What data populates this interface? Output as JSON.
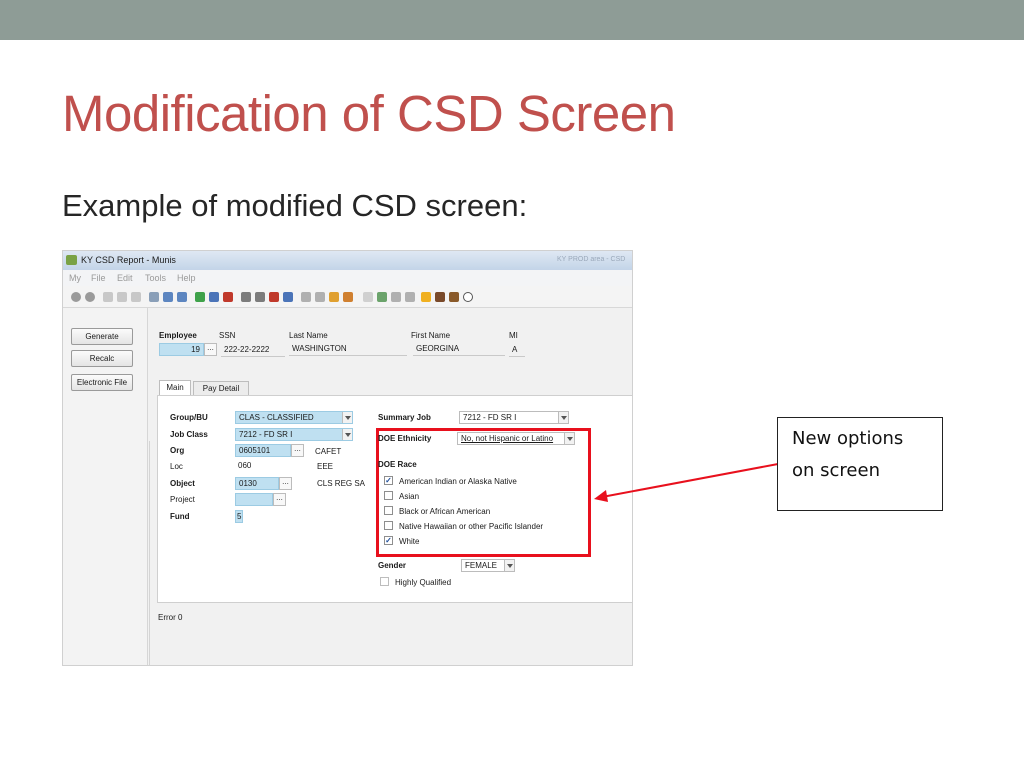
{
  "slide": {
    "title": "Modification of CSD Screen",
    "subtitle": "Example of modified CSD screen:"
  },
  "window": {
    "title": "KY CSD Report - Munis",
    "ghost_text": "KY PROD area - CSD"
  },
  "menu": [
    "My",
    "File",
    "Edit",
    "Tools",
    "Help"
  ],
  "side_buttons": [
    "Generate",
    "Recalc",
    "Electronic File"
  ],
  "header": {
    "employee_label": "Employee",
    "ssn_label": "SSN",
    "last_name_label": "Last Name",
    "first_name_label": "First Name",
    "mi_label": "MI",
    "employee_value": "19",
    "ssn_value": "222-22-2222",
    "last_name_value": "WASHINGTON",
    "first_name_value": "GEORGINA",
    "mi_value": "A"
  },
  "tabs": [
    "Main",
    "Pay Detail"
  ],
  "fields": {
    "group_bu_label": "Group/BU",
    "group_bu_value": "CLAS - CLASSIFIED",
    "job_class_label": "Job Class",
    "job_class_value": "7212 - FD SR I",
    "org_label": "Org",
    "org_value": "0605101",
    "org_desc": "CAFET",
    "loc_label": "Loc",
    "loc_value": "060",
    "loc_desc": "EEE",
    "object_label": "Object",
    "object_value": "0130",
    "object_desc": "CLS REG SA",
    "project_label": "Project",
    "fund_label": "Fund",
    "fund_value": "5",
    "summary_job_label": "Summary Job",
    "summary_job_value": "7212 - FD SR I",
    "doe_ethnicity_label": "DOE Ethnicity",
    "doe_ethnicity_value": "No, not Hispanic or Latino",
    "doe_race_label": "DOE Race",
    "gender_label": "Gender",
    "gender_value": "FEMALE",
    "highly_qualified_label": "Highly Qualified"
  },
  "races": [
    {
      "label": "American Indian or Alaska Native",
      "checked": "✓"
    },
    {
      "label": "Asian",
      "checked": ""
    },
    {
      "label": "Black or African American",
      "checked": ""
    },
    {
      "label": "Native Hawaiian or other Pacific Islander",
      "checked": ""
    },
    {
      "label": "White",
      "checked": "✓"
    }
  ],
  "error_text": "Error  0",
  "annotation": {
    "line1": "New options",
    "line2": "on screen",
    "box_color": "#e8101d"
  },
  "colors": {
    "title": "#c0504d",
    "top_bar": "#8e9c96",
    "highlight_field": "#bfe0f1"
  }
}
